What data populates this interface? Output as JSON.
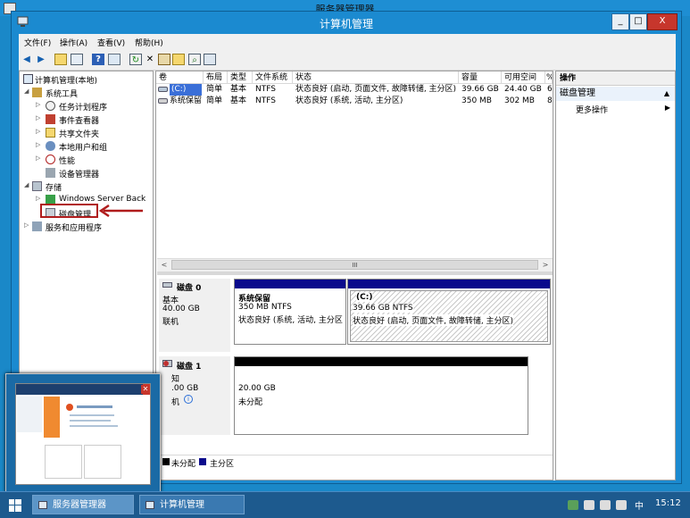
{
  "background_window": {
    "title": "服务器管理器"
  },
  "window": {
    "title": "计算机管理",
    "min": "_",
    "max": "□",
    "close": "X"
  },
  "menu": [
    "文件(F)",
    "操作(A)",
    "查看(V)",
    "帮助(H)"
  ],
  "tree": {
    "root": "计算机管理(本地)",
    "system_tools": "系统工具",
    "task_scheduler": "任务计划程序",
    "event_viewer": "事件查看器",
    "shared_folders": "共享文件夹",
    "local_users": "本地用户和组",
    "performance": "性能",
    "device_manager": "设备管理器",
    "storage": "存储",
    "windows_backup": "Windows Server Back",
    "disk_management": "磁盘管理",
    "services": "服务和应用程序"
  },
  "volume_table": {
    "headers": [
      "卷",
      "布局",
      "类型",
      "文件系统",
      "状态",
      "容量",
      "可用空间",
      "%"
    ],
    "rows": [
      [
        "(C:)",
        "简单",
        "基本",
        "NTFS",
        "状态良好 (启动, 页面文件, 故障转储, 主分区)",
        "39.66 GB",
        "24.40 GB",
        "6"
      ],
      [
        "系统保留",
        "简单",
        "基本",
        "NTFS",
        "状态良好 (系统, 活动, 主分区)",
        "350 MB",
        "302 MB",
        "8"
      ]
    ]
  },
  "scroll": {
    "mid": "III",
    "left": "<",
    "right": ">"
  },
  "disk0": {
    "name": "磁盘 0",
    "type": "基本",
    "size": "40.00 GB",
    "status": "联机",
    "p1": {
      "name": "系统保留",
      "size": "350 MB NTFS",
      "status": "状态良好 (系统, 活动, 主分区"
    },
    "p2": {
      "name": "(C:)",
      "size": "39.66 GB NTFS",
      "status": "状态良好 (启动, 页面文件, 故障转储, 主分区)"
    }
  },
  "disk1": {
    "name": "磁盘 1",
    "type": "知",
    "size": ".00 GB",
    "status": "机",
    "p1": {
      "size": "20.00 GB",
      "status": "未分配"
    }
  },
  "legend": {
    "unalloc": "未分配",
    "primary": "主分区"
  },
  "actions": {
    "header": "操作",
    "group": "磁盘管理",
    "more": "更多操作"
  },
  "taskbar": {
    "app1": "服务器管理器",
    "app2": "计算机管理",
    "ime": "中",
    "time": "15:12"
  },
  "colors": {
    "accent": "#1b8ad0",
    "primary_partition": "#0a0a8c",
    "highlight_box": "#b01c1c"
  }
}
